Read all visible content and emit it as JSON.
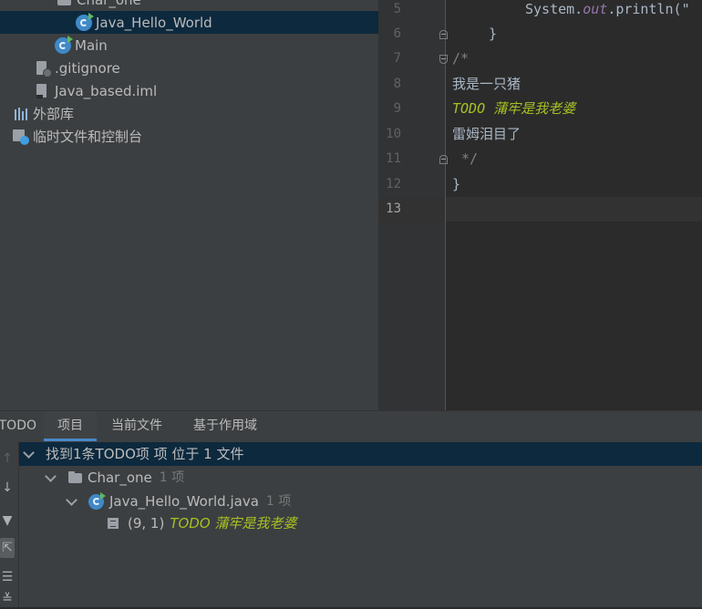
{
  "project_tree": {
    "top_partial_label": "Char_one",
    "items": [
      {
        "label": "Java_Hello_World",
        "icon": "class-icon"
      },
      {
        "label": "Main",
        "icon": "class-icon"
      },
      {
        "label": ".gitignore",
        "icon": "file-icon"
      },
      {
        "label": "Java_based.iml",
        "icon": "iml-file-icon"
      },
      {
        "label": "外部库",
        "icon": "library-icon"
      },
      {
        "label": "临时文件和控制台",
        "icon": "scratch-icon"
      }
    ]
  },
  "editor": {
    "line_numbers": [
      "5",
      "6",
      "7",
      "8",
      "9",
      "10",
      "11",
      "12",
      "13"
    ],
    "current_line": "13",
    "lines": {
      "l5_prefix": "System.",
      "l5_field": "out",
      "l5_suffix": ".println(\"",
      "l6": "}",
      "l7": "/*",
      "l8": "我是一只猪",
      "l9": "TODO 蒲牢是我老婆",
      "l10": "雷姆泪目了",
      "l11": "*/",
      "l12": "}"
    }
  },
  "todo_panel": {
    "title": "TODO:",
    "tabs": [
      "项目",
      "当前文件",
      "基于作用域"
    ],
    "summary": "找到1条TODO项 项 位于 1 文件",
    "folder": {
      "label": "Char_one",
      "count": "1 项"
    },
    "file": {
      "label": "Java_Hello_World.java",
      "count": "1 项"
    },
    "item": {
      "position": "(9, 1)",
      "text": "TODO 蒲牢是我老婆"
    }
  },
  "colors": {
    "accent": "#4a88c7",
    "selection": "#0d293e",
    "todo": "#a8c023"
  }
}
